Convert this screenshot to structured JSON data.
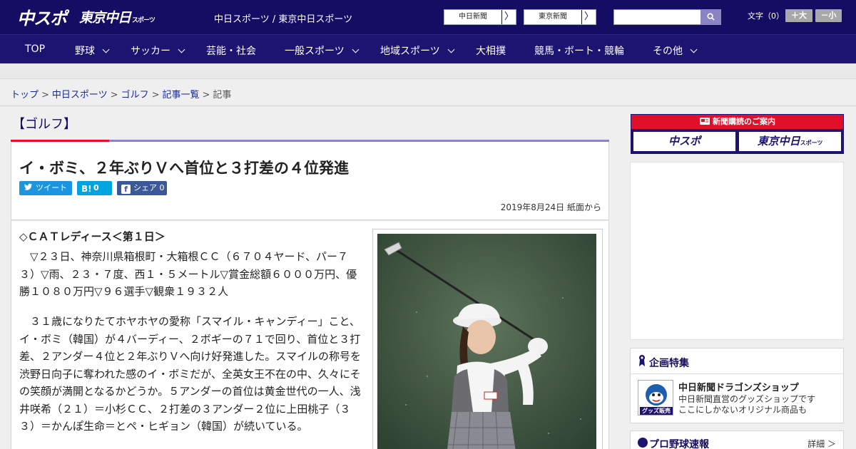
{
  "header": {
    "logo_chusupo": "中スポ",
    "logo_tokyo": "東京中日",
    "logo_tokyo_sub": "スポーツ",
    "site_names": "中日スポーツ / 東京中日スポーツ",
    "paper_links": [
      "中日新聞",
      "東京新聞"
    ],
    "arrow_glyph": "〉",
    "search_placeholder": "",
    "font_size_label": "文字（0）",
    "font_larger": "＋大",
    "font_smaller": "－小"
  },
  "nav": {
    "items": [
      {
        "label": "TOP"
      },
      {
        "label": "野球"
      },
      {
        "label": "サッカー"
      },
      {
        "label": "芸能・社会"
      },
      {
        "label": "一般スポーツ"
      },
      {
        "label": "地域スポーツ"
      },
      {
        "label": "大相撲"
      },
      {
        "label": "競馬・ボート・競輪"
      },
      {
        "label": "その他"
      }
    ]
  },
  "breadcrumb": {
    "items": [
      "トップ",
      "中日スポーツ",
      "ゴルフ",
      "記事一覧"
    ],
    "current": "記事",
    "separator": ">"
  },
  "category": {
    "title": "【ゴルフ】"
  },
  "article": {
    "headline": "イ・ボミ、２年ぶりＶへ首位と３打差の４位発進",
    "share": {
      "tweet": "ツイート",
      "hatena_count": "0",
      "facebook_label": "シェア",
      "facebook_count": "0"
    },
    "date": "2019年8月24日 紙面から",
    "sub_heading": "◇ＣＡＴレディース＜第１日＞",
    "paragraphs": [
      "▽２３日、神奈川県箱根町・大箱根ＣＣ（６７０４ヤード、パー７３）▽雨、２３・７度、西１・５メートル▽賞金総額６０００万円、優勝１０８０万円▽９６選手▽観衆１９３２人",
      "３１歳になりたてホヤホヤの愛称「スマイル・キャンディー」こと、イ・ボミ（韓国）が４バーディー、２ボギーの７１で回り、首位と３打差、２アンダー４位と２年ぶりＶへ向け好発進した。スマイルの称号を渋野日向子に奪われた感のイ・ボミだが、全英女王不在の中、久々にその笑顔が満開となるかどうか。５アンダーの首位は黄金世代の一人、浅井咲希（２１）＝小杉ＣＣ、２打差の３アンダー２位に上田桃子（３３）＝かんぽ生命＝とペ・ヒギョン（韓国）が続いている。"
    ]
  },
  "sidebar": {
    "subscribe_header": "新聞購読のご案内",
    "subscribe_logos": [
      "中スポ",
      "東京中日"
    ],
    "subscribe_logo_sub": "スポーツ",
    "feature": {
      "title": "企画特集",
      "shop_title": "中日新聞ドラゴンズショップ",
      "shop_desc_1": "中日新聞直営のグッズショップです",
      "shop_desc_2": "ここにしかないオリジナル商品も",
      "thumb_label": "グッズ販売中"
    },
    "baseball": {
      "title": "プロ野球速報",
      "more": "詳細 ＞"
    }
  },
  "colors": {
    "header_bg": "#140d63",
    "nav_bg": "#1c1470",
    "accent_red": "#e0102a",
    "accent_purple": "#8a83c4",
    "twitter": "#1b95e0",
    "hatena": "#00a4de",
    "facebook": "#3b5998"
  }
}
